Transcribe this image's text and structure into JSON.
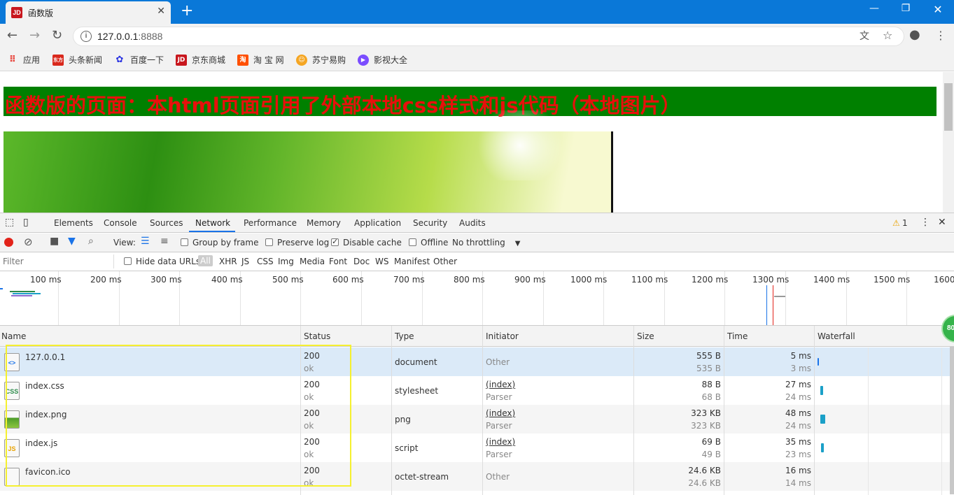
{
  "browser": {
    "tab_title": "函数版",
    "tab_favicon": "JD",
    "url_host": "127.0.0.1",
    "url_port": ":8888"
  },
  "bookmarks": [
    {
      "label": "应用",
      "icon": "apps-grid-icon",
      "color": "#e8453c"
    },
    {
      "label": "头条新闻",
      "icon": "toutiao-icon",
      "color": "#d9281c"
    },
    {
      "label": "百度一下",
      "icon": "baidu-paw-icon",
      "color": "#2932e1"
    },
    {
      "label": "京东商城",
      "icon": "jd-icon",
      "color": "#c8171e"
    },
    {
      "label": "淘 宝 网",
      "icon": "taobao-icon",
      "color": "#ff5000"
    },
    {
      "label": "苏宁易购",
      "icon": "suning-icon",
      "color": "#f5a623"
    },
    {
      "label": "影视大全",
      "icon": "video-play-icon",
      "color": "#7b4dff"
    }
  ],
  "page": {
    "banner_text": "函数版的页面：本html页面引用了外部本地css样式和js代码（本地图片）"
  },
  "devtools": {
    "tabs": [
      "Elements",
      "Console",
      "Sources",
      "Network",
      "Performance",
      "Memory",
      "Application",
      "Security",
      "Audits"
    ],
    "active_tab": "Network",
    "warning_count": "1",
    "toolbar": {
      "view_label": "View:",
      "group_by_frame": "Group by frame",
      "preserve_log": "Preserve log",
      "disable_cache": "Disable cache",
      "offline": "Offline",
      "throttling": "No throttling"
    },
    "filter": {
      "placeholder": "Filter",
      "hide_data_urls": "Hide data URLs",
      "types": [
        "All",
        "XHR",
        "JS",
        "CSS",
        "Img",
        "Media",
        "Font",
        "Doc",
        "WS",
        "Manifest",
        "Other"
      ]
    },
    "timeline_ticks": [
      "100 ms",
      "200 ms",
      "300 ms",
      "400 ms",
      "500 ms",
      "600 ms",
      "700 ms",
      "800 ms",
      "900 ms",
      "1000 ms",
      "1100 ms",
      "1200 ms",
      "1300 ms",
      "1400 ms",
      "1500 ms",
      "1600"
    ],
    "columns": [
      "Name",
      "Status",
      "Type",
      "Initiator",
      "Size",
      "Time",
      "Waterfall"
    ],
    "requests": [
      {
        "name": "127.0.0.1",
        "icon": "html-document-icon",
        "status": "200",
        "status_text": "ok",
        "type": "document",
        "initiator": "Other",
        "initiator_sub": "",
        "size": "555 B",
        "size_sub": "535 B",
        "time": "5 ms",
        "time_sub": "3 ms"
      },
      {
        "name": "index.css",
        "icon": "css-file-icon",
        "status": "200",
        "status_text": "ok",
        "type": "stylesheet",
        "initiator": "(index)",
        "initiator_sub": "Parser",
        "size": "88 B",
        "size_sub": "68 B",
        "time": "27 ms",
        "time_sub": "24 ms"
      },
      {
        "name": "index.png",
        "icon": "image-file-icon",
        "status": "200",
        "status_text": "ok",
        "type": "png",
        "initiator": "(index)",
        "initiator_sub": "Parser",
        "size": "323 KB",
        "size_sub": "323 KB",
        "time": "48 ms",
        "time_sub": "24 ms"
      },
      {
        "name": "index.js",
        "icon": "js-file-icon",
        "status": "200",
        "status_text": "ok",
        "type": "script",
        "initiator": "(index)",
        "initiator_sub": "Parser",
        "size": "69 B",
        "size_sub": "49 B",
        "time": "35 ms",
        "time_sub": "23 ms"
      },
      {
        "name": "favicon.ico",
        "icon": "blank-file-icon",
        "status": "200",
        "status_text": "ok",
        "type": "octet-stream",
        "initiator": "Other",
        "initiator_sub": "",
        "size": "24.6 KB",
        "size_sub": "24.6 KB",
        "time": "16 ms",
        "time_sub": "14 ms"
      }
    ],
    "floating_badge": "80"
  },
  "colors": {
    "titlebar": "#0a78d8",
    "banner_bg": "#008000",
    "banner_text": "#e8100c",
    "highlight_box": "#f5f030",
    "selected_row": "#dbeaf8"
  }
}
